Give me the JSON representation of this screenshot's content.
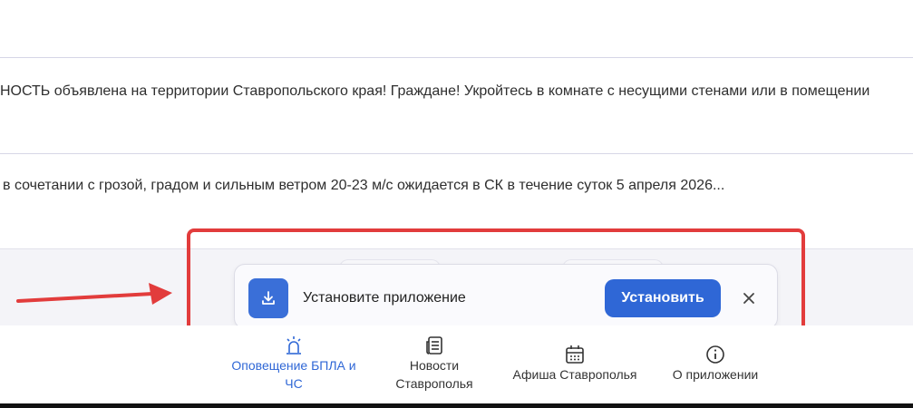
{
  "feed": [
    {
      "text": ""
    },
    {
      "text": "НОСТЬ объявлена на территории Ставропольского края! Граждане! Укройтесь в комнате с несущими стенами или в помещении"
    },
    {
      "text": "в сочетании с грозой, градом и сильным ветром 20-23 м/с ожидается в СК в течение суток 5 апреля 2026..."
    }
  ],
  "install_banner": {
    "text": "Установите приложение",
    "button_label": "Установить",
    "icon": "download-icon",
    "close_icon": "close-icon"
  },
  "bottom_nav": [
    {
      "label": "Оповещение БПЛА и ЧС",
      "icon": "siren-icon",
      "active": true
    },
    {
      "label": "Новости Ставрополья",
      "icon": "newspaper-icon",
      "active": false
    },
    {
      "label": "Афиша Ставрополья",
      "icon": "calendar-icon",
      "active": false
    },
    {
      "label": "О приложении",
      "icon": "info-icon",
      "active": false
    }
  ],
  "colors": {
    "accent": "#2f67d6",
    "highlight": "#e23c3c",
    "divider": "#d6d6e6"
  }
}
